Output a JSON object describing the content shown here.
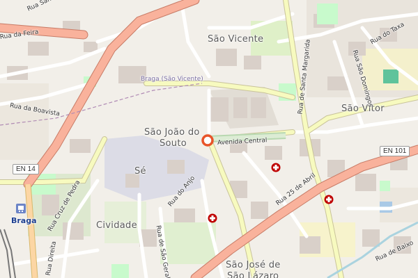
{
  "map": {
    "places": {
      "sao_vicente": "São Vicente",
      "sao_vitor": "São Vítor",
      "sao_joao_line1": "São João do",
      "sao_joao_line2": "Souto",
      "se": "Sé",
      "cividade": "Cividade",
      "sao_jose_line1": "São José de",
      "sao_jose_line2": "São Lázaro",
      "braga": "Braga",
      "braga_sao_vicente": "Braga (São Vicente)"
    },
    "streets": {
      "rua_da_feira": "Rua da Feira",
      "rua_da_boavista": "Rua da Boavista",
      "rua_santo_antonio": "Rua Santo António",
      "rua_de_santa_margarida": "Rua de Santa Margarida",
      "rua_sao_domingos": "Rua São Domingos",
      "rua_do_taxa": "Rua do Taxa",
      "avenida_central": "Avenida Central",
      "rua_do_anjo": "Rua do Anjo",
      "rua_25_de_abril": "Rua 25 de Abril",
      "rua_cruz_de_pedra": "Rua Cruz de Pedra",
      "rua_direita": "Rua Direita",
      "rua_de_sao_geraldo": "Rua de São Geraldo",
      "rua_de_baixo": "Rua de Baixo"
    },
    "shields": {
      "en14": "EN 14",
      "en101": "EN 101"
    },
    "colors": {
      "background": "#f2efe9",
      "trunk": "#f9b29c",
      "secondary": "#f7fabf",
      "residential": "#ffffff",
      "building": "#d9d0c9",
      "park": "#c8facc",
      "pedestrian": "#dddde8",
      "marker": "#e8542a",
      "hospital_cross": "#bf0000"
    },
    "icons": [
      "location-marker-icon",
      "hospital-icon",
      "railway-station-icon"
    ]
  }
}
